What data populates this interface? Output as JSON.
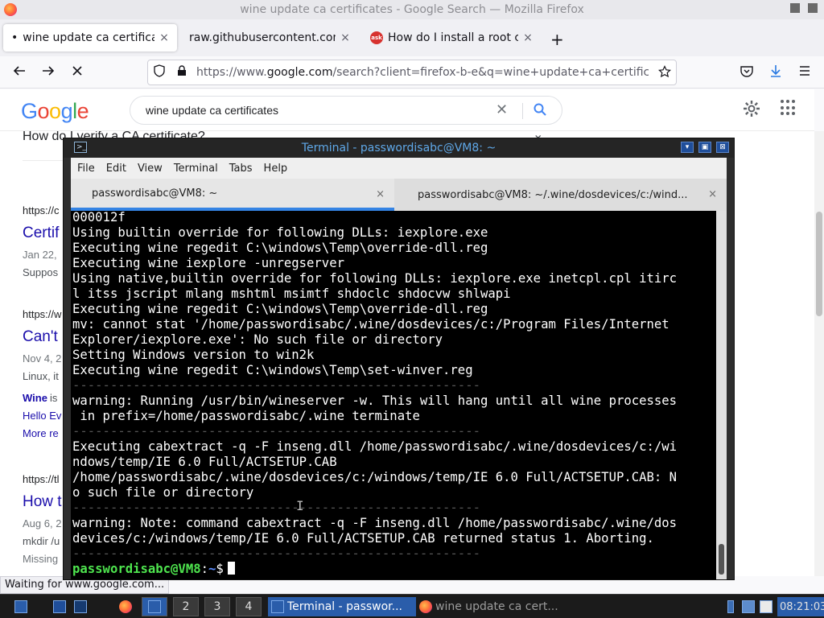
{
  "browser": {
    "window_title": "wine update ca certificates - Google Search — Mozilla Firefox",
    "tabs": [
      {
        "label": "wine update ca certificat",
        "bullet": "•",
        "close": "×"
      },
      {
        "label": "raw.githubusercontent.com/",
        "close": "×"
      },
      {
        "label": "How do I install a root ce",
        "icon_text": "ask",
        "close": "×"
      }
    ],
    "new_tab": "+",
    "url": {
      "prefix": "https://www.",
      "domain": "google.com",
      "rest": "/search?client=firefox-b-e&q=wine+update+ca+certific"
    },
    "status": "Waiting for www.google.com..."
  },
  "google": {
    "logo": [
      "G",
      "o",
      "o",
      "g",
      "l",
      "e"
    ],
    "query": "wine update ca certificates",
    "clear": "✕",
    "visible_fragments": {
      "faq": "How do I verify a CA certificate?",
      "faq_chevron": "⌄",
      "url1": "https://c",
      "title1": "Certif",
      "date1": "Jan 22,",
      "snip1": "Suppos",
      "url2": "https://w",
      "title2": "Can't",
      "date2": "Nov 4, 2",
      "snip2": "Linux, it",
      "link_wine": "Wine",
      "snip2b": " is",
      "link_hello": "Hello Ev",
      "link_more": "More re",
      "url3": "https://tl",
      "title3": "How t",
      "date3": "Aug 6, 2",
      "snip3": "mkdir /u",
      "snip3b": "Missing"
    }
  },
  "terminal": {
    "title": "Terminal - passwordisabc@VM8: ~",
    "menu": [
      "File",
      "Edit",
      "View",
      "Terminal",
      "Tabs",
      "Help"
    ],
    "tabs": [
      {
        "label": "passwordisabc@VM8: ~",
        "close": "×"
      },
      {
        "label": "passwordisabc@VM8: ~/.wine/dosdevices/c:/wind...",
        "close": "×"
      }
    ],
    "lines": [
      "000012f",
      "Using builtin override for following DLLs: iexplore.exe",
      "Executing wine regedit C:\\windows\\Temp\\override-dll.reg",
      "Executing wine iexplore -unregserver",
      "Using native,builtin override for following DLLs: iexplore.exe inetcpl.cpl itirc",
      "l itss jscript mlang mshtml msimtf shdoclc shdocvw shlwapi",
      "Executing wine regedit C:\\windows\\Temp\\override-dll.reg",
      "mv: cannot stat '/home/passwordisabc/.wine/dosdevices/c:/Program Files/Internet",
      "Explorer/iexplore.exe': No such file or directory",
      "Setting Windows version to win2k",
      "Executing wine regedit C:\\windows\\Temp\\set-winver.reg",
      "------------------------------------------------------",
      "warning: Running /usr/bin/wineserver -w. This will hang until all wine processes",
      " in prefix=/home/passwordisabc/.wine terminate",
      "------------------------------------------------------",
      "Executing cabextract -q -F inseng.dll /home/passwordisabc/.wine/dosdevices/c:/wi",
      "ndows/temp/IE 6.0 Full/ACTSETUP.CAB",
      "/home/passwordisabc/.wine/dosdevices/c:/windows/temp/IE 6.0 Full/ACTSETUP.CAB: N",
      "o such file or directory",
      "------------------------------------------------------",
      "warning: Note: command cabextract -q -F inseng.dll /home/passwordisabc/.wine/dos",
      "devices/c:/windows/temp/IE 6.0 Full/ACTSETUP.CAB returned status 1. Aborting.",
      "------------------------------------------------------"
    ],
    "prompt_user": "passwordisabc@VM8",
    "prompt_sep": ":",
    "prompt_path": "~",
    "prompt_end": "$"
  },
  "taskbar": {
    "workspaces": [
      "2",
      "3",
      "4"
    ],
    "tasks": [
      {
        "label": "Terminal - passwor..."
      },
      {
        "label": "wine update ca cert..."
      }
    ],
    "clock": "08:21:03"
  }
}
